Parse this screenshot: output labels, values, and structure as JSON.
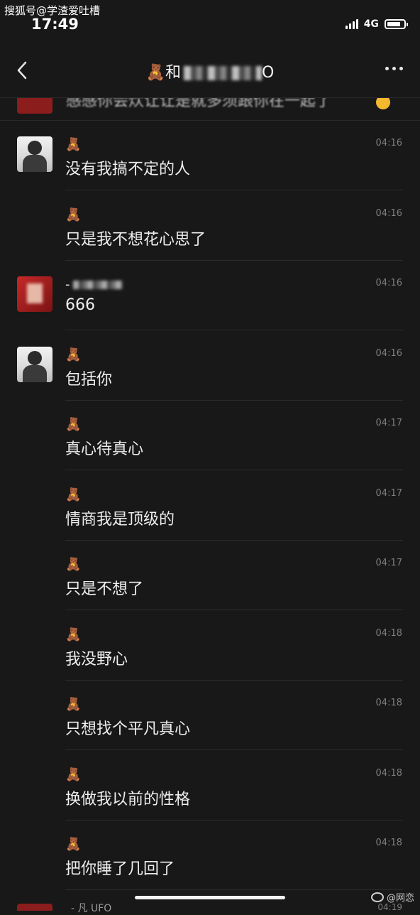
{
  "watermark_top": "搜狐号@学渣爱吐槽",
  "watermark_bottom": "@网恋",
  "status": {
    "time": "17:49",
    "network": "4G"
  },
  "header": {
    "title_prefix": "🧸和",
    "title_suffix": "O"
  },
  "partial_message": {
    "text": "感感你会炊让让是就多须跟你在一起了"
  },
  "messages": [
    {
      "sender": "🧸",
      "time": "04:16",
      "text": "没有我搞不定的人"
    },
    {
      "sender": "🧸",
      "time": "04:16",
      "text": "只是我不想花心思了"
    },
    {
      "sender": "-",
      "time": "04:16",
      "text": "666"
    },
    {
      "sender": "🧸",
      "time": "04:16",
      "text": "包括你"
    },
    {
      "sender": "🧸",
      "time": "04:17",
      "text": "真心待真心"
    },
    {
      "sender": "🧸",
      "time": "04:17",
      "text": "情商我是顶级的"
    },
    {
      "sender": "🧸",
      "time": "04:17",
      "text": "只是不想了"
    },
    {
      "sender": "🧸",
      "time": "04:18",
      "text": "我没野心"
    },
    {
      "sender": "🧸",
      "time": "04:18",
      "text": "只想找个平凡真心"
    },
    {
      "sender": "🧸",
      "time": "04:18",
      "text": "换做我以前的性格"
    },
    {
      "sender": "🧸",
      "time": "04:18",
      "text": "把你睡了几回了"
    }
  ],
  "bottom_peek": {
    "text": "- 凡 UFO",
    "time": "04:19"
  },
  "icons": {
    "back": "chevron-left-icon",
    "more": "more-horizontal-icon",
    "battery": "battery-icon",
    "signal": "signal-icon",
    "weibo": "weibo-logo"
  }
}
